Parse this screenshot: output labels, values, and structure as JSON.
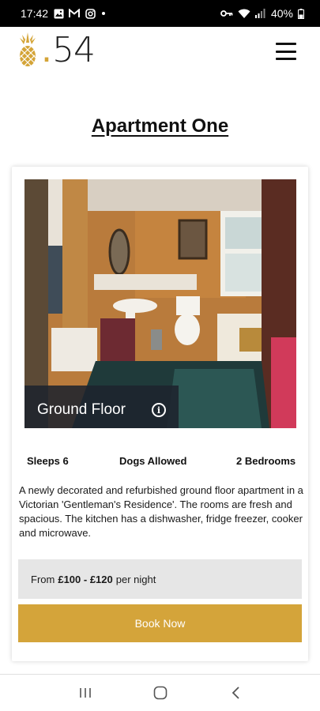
{
  "status_bar": {
    "time": "17:42",
    "battery": "40%",
    "left_icons": [
      "image-icon",
      "gmail-icon",
      "instagram-icon",
      "notification-dot"
    ],
    "right_icons": [
      "vpn-key-icon",
      "wifi-icon",
      "signal-icon",
      "battery-icon"
    ]
  },
  "header": {
    "logo_dot": ".",
    "logo_number": "54",
    "logo_icon": "pineapple-icon",
    "menu_icon": "hamburger-menu-icon"
  },
  "page": {
    "title": "Apartment One"
  },
  "listing": {
    "floor_label": "Ground Floor",
    "info_icon": "info-icon",
    "features": [
      "Sleeps 6",
      "Dogs Allowed",
      "2 Bedrooms"
    ],
    "description": "A newly decorated and refurbished ground floor apartment in a Victorian 'Gentleman's Residence'. The rooms are fresh and spacious. The kitchen has a dishwasher, fridge freezer, cooker and microwave.",
    "price_prefix": "From",
    "price_range": "£100 - £120",
    "price_suffix": "per night",
    "book_label": "Book Now"
  },
  "nav_bar": {
    "icons": [
      "recent-apps-icon",
      "home-icon",
      "back-icon"
    ]
  },
  "colors": {
    "accent_gold": "#d4a43a",
    "price_bg": "#e6e6e6",
    "label_overlay": "#1e232d"
  }
}
